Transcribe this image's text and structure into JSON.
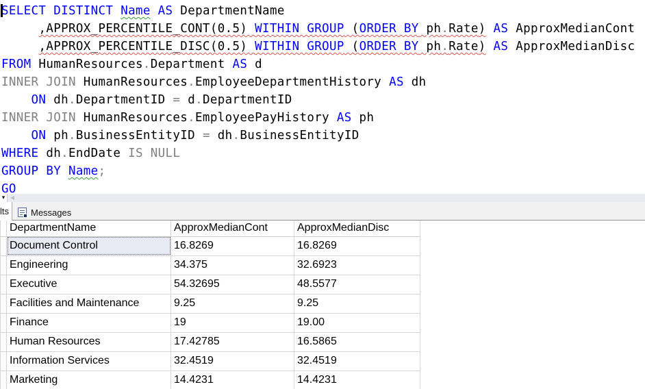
{
  "colors": {
    "keyword_blue": "#0000ff",
    "operator_gray": "#808080",
    "identifier_black": "#000000",
    "squiggle_red": "#e0534e",
    "squiggle_green": "#3a9e3a",
    "selected_cell_bg": "#e8ebf3"
  },
  "editor": {
    "caret_visible": true,
    "lines": [
      {
        "runs": [
          {
            "sq": null,
            "segs": [
              [
                "SELECT",
                "b"
              ],
              [
                " ",
                "k"
              ],
              [
                "DISTINCT",
                "b"
              ],
              [
                " ",
                "k"
              ]
            ]
          },
          {
            "sq": "green",
            "segs": [
              [
                "Name",
                "b"
              ]
            ]
          },
          {
            "sq": null,
            "segs": [
              [
                " ",
                "k"
              ],
              [
                "AS",
                "b"
              ],
              [
                " DepartmentName",
                "k"
              ]
            ]
          }
        ]
      },
      {
        "runs": [
          {
            "sq": null,
            "segs": [
              [
                "     ",
                "k"
              ]
            ]
          },
          {
            "sq": "red",
            "segs": [
              [
                ",APPROX_PERCENTILE_CONT(0.5) ",
                "k"
              ],
              [
                "WITHIN GROUP",
                "b"
              ],
              [
                " (",
                "k"
              ],
              [
                "ORDER BY",
                "b"
              ],
              [
                " ph",
                "k"
              ],
              [
                ".",
                "g"
              ],
              [
                "Rate",
                "k"
              ],
              [
                ")",
                "k"
              ]
            ]
          },
          {
            "sq": null,
            "segs": [
              [
                " ",
                "k"
              ],
              [
                "AS",
                "b"
              ],
              [
                " ApproxMedianCont",
                "k"
              ]
            ]
          }
        ]
      },
      {
        "runs": [
          {
            "sq": null,
            "segs": [
              [
                "     ",
                "k"
              ]
            ]
          },
          {
            "sq": "red",
            "segs": [
              [
                ",APPROX_PERCENTILE_DISC(0.5) ",
                "k"
              ],
              [
                "WITHIN GROUP",
                "b"
              ],
              [
                " (",
                "k"
              ],
              [
                "ORDER BY",
                "b"
              ],
              [
                " ph",
                "k"
              ],
              [
                ".",
                "g"
              ],
              [
                "Rate",
                "k"
              ],
              [
                ")",
                "k"
              ]
            ]
          },
          {
            "sq": null,
            "segs": [
              [
                " ",
                "k"
              ],
              [
                "AS",
                "b"
              ],
              [
                " ApproxMedianDisc",
                "k"
              ]
            ]
          }
        ]
      },
      {
        "runs": [
          {
            "sq": null,
            "segs": [
              [
                "FROM",
                "b"
              ],
              [
                " HumanResources",
                "k"
              ],
              [
                ".",
                "g"
              ],
              [
                "Department",
                "k"
              ],
              [
                " ",
                "k"
              ],
              [
                "AS",
                "b"
              ],
              [
                " d",
                "k"
              ]
            ]
          }
        ]
      },
      {
        "runs": [
          {
            "sq": null,
            "segs": [
              [
                "INNER JOIN",
                "g"
              ],
              [
                " HumanResources",
                "k"
              ],
              [
                ".",
                "g"
              ],
              [
                "EmployeeDepartmentHistory",
                "k"
              ],
              [
                " ",
                "k"
              ],
              [
                "AS",
                "b"
              ],
              [
                " dh",
                "k"
              ]
            ]
          }
        ]
      },
      {
        "runs": [
          {
            "sq": null,
            "segs": [
              [
                "    ",
                "k"
              ],
              [
                "ON",
                "b"
              ],
              [
                " dh",
                "k"
              ],
              [
                ".",
                "g"
              ],
              [
                "DepartmentID",
                "k"
              ],
              [
                " ",
                "k"
              ],
              [
                "=",
                "g"
              ],
              [
                " d",
                "k"
              ],
              [
                ".",
                "g"
              ],
              [
                "DepartmentID",
                "k"
              ]
            ]
          }
        ]
      },
      {
        "runs": [
          {
            "sq": null,
            "segs": [
              [
                "INNER JOIN",
                "g"
              ],
              [
                " HumanResources",
                "k"
              ],
              [
                ".",
                "g"
              ],
              [
                "EmployeePayHistory",
                "k"
              ],
              [
                " ",
                "k"
              ],
              [
                "AS",
                "b"
              ],
              [
                " ph",
                "k"
              ]
            ]
          }
        ]
      },
      {
        "runs": [
          {
            "sq": null,
            "segs": [
              [
                "    ",
                "k"
              ],
              [
                "ON",
                "b"
              ],
              [
                " ph",
                "k"
              ],
              [
                ".",
                "g"
              ],
              [
                "BusinessEntityID",
                "k"
              ],
              [
                " ",
                "k"
              ],
              [
                "=",
                "g"
              ],
              [
                " dh",
                "k"
              ],
              [
                ".",
                "g"
              ],
              [
                "BusinessEntityID",
                "k"
              ]
            ]
          }
        ]
      },
      {
        "runs": [
          {
            "sq": null,
            "segs": [
              [
                "WHERE",
                "b"
              ],
              [
                " dh",
                "k"
              ],
              [
                ".",
                "g"
              ],
              [
                "EndDate",
                "k"
              ],
              [
                " ",
                "k"
              ],
              [
                "IS NULL",
                "g"
              ]
            ]
          }
        ]
      },
      {
        "runs": [
          {
            "sq": null,
            "segs": [
              [
                "GROUP BY",
                "b"
              ],
              [
                " ",
                "k"
              ]
            ]
          },
          {
            "sq": "green",
            "segs": [
              [
                "Name",
                "b"
              ]
            ]
          },
          {
            "sq": null,
            "segs": [
              [
                ";",
                "g"
              ]
            ]
          }
        ]
      },
      {
        "runs": [
          {
            "sq": null,
            "segs": [
              [
                "GO",
                "b"
              ]
            ]
          }
        ]
      }
    ]
  },
  "scrollbar": {
    "dropdown_glyph": "▾",
    "scroll_left_glyph": "◀"
  },
  "results_pane": {
    "results_tab_label": "lts",
    "messages_tab_label": "Messages",
    "grid": {
      "columns": [
        "DepartmentName",
        "ApproxMedianCont",
        "ApproxMedianDisc"
      ],
      "rows": [
        [
          "Document Control",
          "16.8269",
          "16.8269"
        ],
        [
          "Engineering",
          "34.375",
          "32.6923"
        ],
        [
          "Executive",
          "54.32695",
          "48.5577"
        ],
        [
          "Facilities and Maintenance",
          "9.25",
          "9.25"
        ],
        [
          "Finance",
          "19",
          "19.00"
        ],
        [
          "Human Resources",
          "17.42785",
          "16.5865"
        ],
        [
          "Information Services",
          "32.4519",
          "32.4519"
        ],
        [
          "Marketing",
          "14.4231",
          "14.4231"
        ]
      ],
      "selected_cell": {
        "row": 0,
        "col": 0
      }
    }
  }
}
